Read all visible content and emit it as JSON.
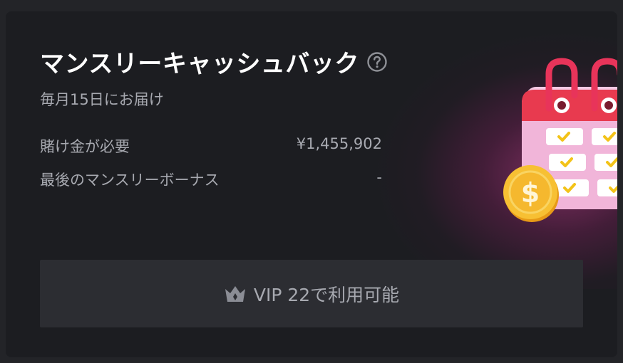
{
  "cashback": {
    "title": "マンスリーキャッシュバック",
    "subtitle": "毎月15日にお届け",
    "rows": [
      {
        "label": "賭け金が必要",
        "value": "¥1,455,902"
      },
      {
        "label": "最後のマンスリーボーナス",
        "value": "-"
      }
    ],
    "cta_label": "VIP 22で利用可能"
  },
  "icons": {
    "help": "question-circle-icon",
    "crown": "crown-icon",
    "illustration": "calendar-coin-illustration"
  },
  "colors": {
    "card_bg": "#1c1d21",
    "page_bg": "#232428",
    "button_bg": "#2c2d32",
    "text_muted": "#a7a9b0",
    "accent_red": "#e83a4f",
    "coin_gold": "#f5b82e"
  }
}
